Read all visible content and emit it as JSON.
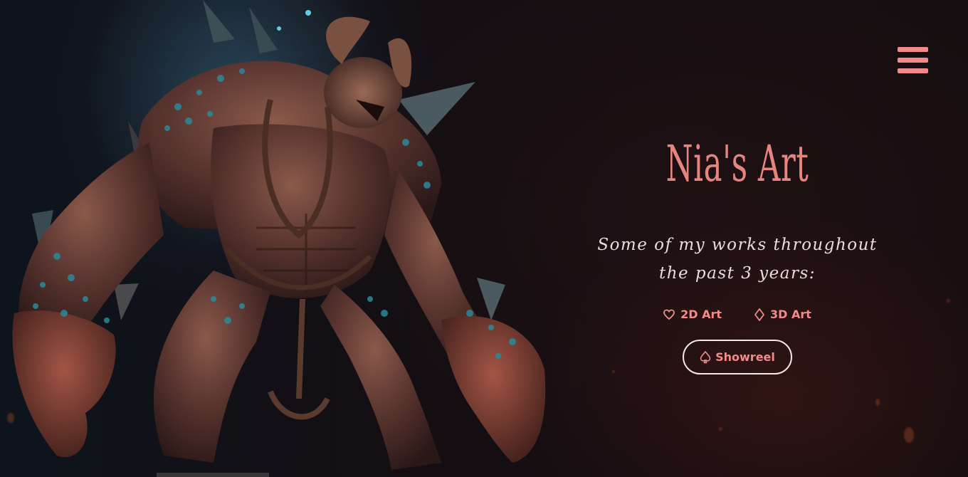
{
  "header": {
    "menu_icon": "hamburger-menu-icon",
    "menu_color": "#f28a8a"
  },
  "hero": {
    "title": "Nia's Art",
    "subtitle": "Some of my works throughout the past 3 years:",
    "image_icon": "creature-artwork",
    "links": [
      {
        "label": "2D Art",
        "icon": "heart-outline-icon"
      },
      {
        "label": "3D Art",
        "icon": "diamond-outline-icon"
      }
    ],
    "showreel": {
      "label": "Showreel",
      "icon": "spade-outline-icon"
    }
  },
  "colors": {
    "accent": "#f28a8a",
    "title": "#e68580",
    "text": "#e9dedb",
    "background": "#0d0b0e"
  }
}
